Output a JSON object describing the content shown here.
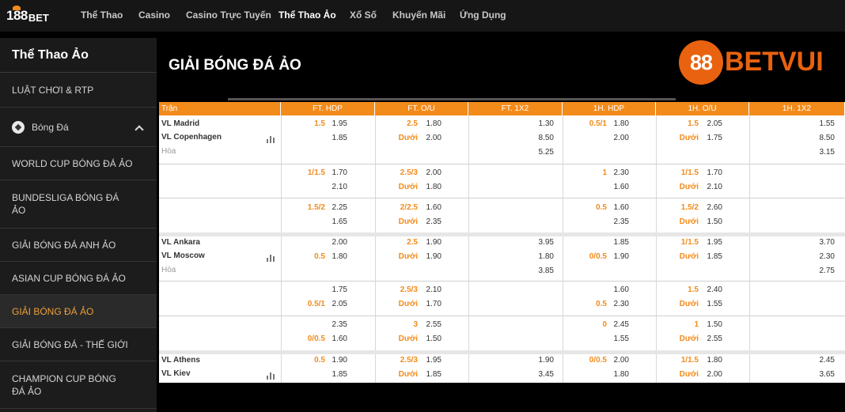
{
  "nav": {
    "logo_num": "188",
    "logo_bet": "BET",
    "items": [
      "Thể Thao",
      "Casino",
      "Casino Trực Tuyến",
      "Thể Thao Ảo",
      "Xổ Số",
      "Khuyến Mãi",
      "Ứng Dụng"
    ],
    "active_index": 3
  },
  "sidebar": {
    "title": "Thể Thao Ảo",
    "items": [
      "LUẬT CHƠI & RTP",
      "Bóng Đá",
      "WORLD CUP BÓNG ĐÁ ẢO",
      "BUNDESLIGA BÓNG ĐÁ ẢO",
      "GIẢI BÓNG ĐÁ ANH ẢO",
      "ASIAN CUP BÓNG ĐÁ ẢO",
      "GIẢI BÓNG ĐÁ ẢO",
      "GIẢI BÓNG ĐÁ - THẾ GIỚI",
      "CHAMPION CUP BÓNG ĐÁ ẢO"
    ],
    "active_index": 6
  },
  "main": {
    "title": "GIẢI BÓNG ĐÁ ẢO",
    "brand_circle": "88",
    "brand_text": "BETVUI"
  },
  "table": {
    "headers": [
      "Trận",
      "FT. HDP",
      "FT. O/U",
      "FT. 1X2",
      "1H. HDP",
      "1H. O/U",
      "1H. 1X2"
    ],
    "draw_label": "Hòa",
    "under_label": "Dưới",
    "matches": [
      {
        "home": "VL Madrid",
        "away": "VL Copenhagen",
        "rows": [
          {
            "ft_hdp": [
              "1.5",
              "1.95",
              "",
              "1.85"
            ],
            "ft_ou": [
              "2.5",
              "1.80",
              "Dưới",
              "2.00"
            ],
            "ft_1x2": [
              "1.30",
              "8.50",
              "5.25"
            ],
            "h1_hdp": [
              "0.5/1",
              "1.80",
              "",
              "2.00"
            ],
            "h1_ou": [
              "1.5",
              "2.05",
              "Dưới",
              "1.75"
            ],
            "h1_1x2": [
              "1.55",
              "8.50",
              "3.15"
            ]
          },
          {
            "ft_hdp": [
              "1/1.5",
              "1.70",
              "",
              "2.10"
            ],
            "ft_ou": [
              "2.5/3",
              "2.00",
              "Dưới",
              "1.80"
            ],
            "ft_1x2": [
              "",
              "",
              ""
            ],
            "h1_hdp": [
              "1",
              "2.30",
              "",
              "1.60"
            ],
            "h1_ou": [
              "1/1.5",
              "1.70",
              "Dưới",
              "2.10"
            ],
            "h1_1x2": [
              "",
              "",
              ""
            ]
          },
          {
            "ft_hdp": [
              "1.5/2",
              "2.25",
              "",
              "1.65"
            ],
            "ft_ou": [
              "2/2.5",
              "1.60",
              "Dưới",
              "2.35"
            ],
            "ft_1x2": [
              "",
              "",
              ""
            ],
            "h1_hdp": [
              "0.5",
              "1.60",
              "",
              "2.35"
            ],
            "h1_ou": [
              "1.5/2",
              "2.60",
              "Dưới",
              "1.50"
            ],
            "h1_1x2": [
              "",
              "",
              ""
            ]
          }
        ]
      },
      {
        "home": "VL Ankara",
        "away": "VL Moscow",
        "rows": [
          {
            "ft_hdp": [
              "",
              "2.00",
              "0.5",
              "1.80"
            ],
            "ft_ou": [
              "2.5",
              "1.90",
              "Dưới",
              "1.90"
            ],
            "ft_1x2": [
              "3.95",
              "1.80",
              "3.85"
            ],
            "h1_hdp": [
              "",
              "1.85",
              "0/0.5",
              "1.90"
            ],
            "h1_ou": [
              "1/1.5",
              "1.95",
              "Dưới",
              "1.85"
            ],
            "h1_1x2": [
              "3.70",
              "2.30",
              "2.75"
            ]
          },
          {
            "ft_hdp": [
              "",
              "1.75",
              "0.5/1",
              "2.05"
            ],
            "ft_ou": [
              "2.5/3",
              "2.10",
              "Dưới",
              "1.70"
            ],
            "ft_1x2": [
              "",
              "",
              ""
            ],
            "h1_hdp": [
              "",
              "1.60",
              "0.5",
              "2.30"
            ],
            "h1_ou": [
              "1.5",
              "2.40",
              "Dưới",
              "1.55"
            ],
            "h1_1x2": [
              "",
              "",
              ""
            ]
          },
          {
            "ft_hdp": [
              "",
              "2.35",
              "0/0.5",
              "1.60"
            ],
            "ft_ou": [
              "3",
              "2.55",
              "Dưới",
              "1.50"
            ],
            "ft_1x2": [
              "",
              "",
              ""
            ],
            "h1_hdp": [
              "0",
              "2.45",
              "",
              "1.55"
            ],
            "h1_ou": [
              "1",
              "1.50",
              "Dưới",
              "2.55"
            ],
            "h1_1x2": [
              "",
              "",
              ""
            ]
          }
        ]
      },
      {
        "home": "VL Athens",
        "away": "VL Kiev",
        "rows": [
          {
            "ft_hdp": [
              "0.5",
              "1.90",
              "",
              "1.85"
            ],
            "ft_ou": [
              "2.5/3",
              "1.95",
              "Dưới",
              "1.85"
            ],
            "ft_1x2": [
              "1.90",
              "3.45",
              ""
            ],
            "h1_hdp": [
              "0/0.5",
              "2.00",
              "",
              "1.80"
            ],
            "h1_ou": [
              "1/1.5",
              "1.80",
              "Dưới",
              "2.00"
            ],
            "h1_1x2": [
              "2.45",
              "3.65",
              ""
            ]
          }
        ]
      }
    ]
  }
}
